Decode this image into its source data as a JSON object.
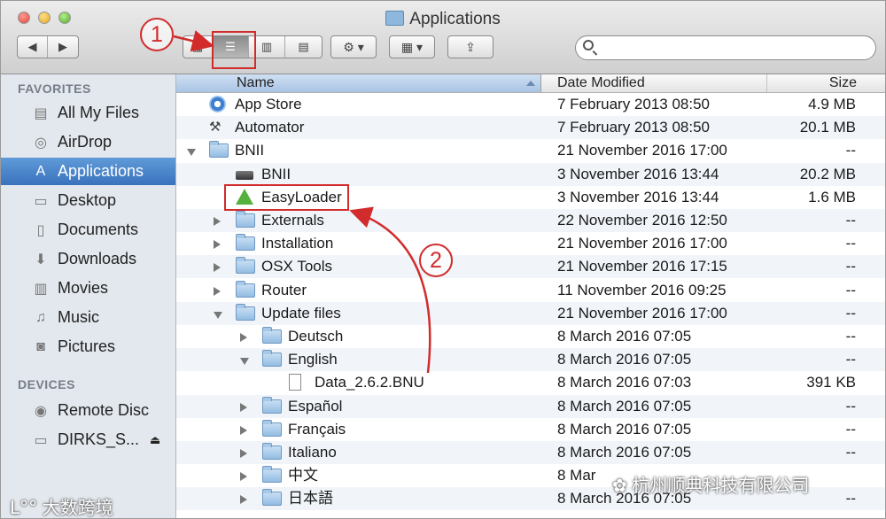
{
  "window": {
    "title": "Applications",
    "toolbar": {
      "back_label": "◀",
      "forward_label": "▶",
      "view_buttons": [
        "▦",
        "☰",
        "▥",
        "▤"
      ],
      "action_label": "⚙ ▾",
      "arrange_label": "▦ ▾",
      "share_label": "⇪"
    },
    "search": {
      "placeholder": ""
    }
  },
  "sidebar": {
    "favorites_heading": "FAVORITES",
    "favorites": [
      {
        "label": "All My Files",
        "icon": "all-files-icon",
        "glyph": "▤"
      },
      {
        "label": "AirDrop",
        "icon": "airdrop-icon",
        "glyph": "◎"
      },
      {
        "label": "Applications",
        "icon": "applications-icon",
        "glyph": "A"
      },
      {
        "label": "Desktop",
        "icon": "desktop-icon",
        "glyph": "▭"
      },
      {
        "label": "Documents",
        "icon": "documents-icon",
        "glyph": "▯"
      },
      {
        "label": "Downloads",
        "icon": "downloads-icon",
        "glyph": "⬇"
      },
      {
        "label": "Movies",
        "icon": "movies-icon",
        "glyph": "▥"
      },
      {
        "label": "Music",
        "icon": "music-icon",
        "glyph": "♫"
      },
      {
        "label": "Pictures",
        "icon": "pictures-icon",
        "glyph": "◙"
      }
    ],
    "selected_index": 2,
    "devices_heading": "DEVICES",
    "devices": [
      {
        "label": "Remote Disc",
        "icon": "disc-icon",
        "glyph": "◉"
      },
      {
        "label": "DIRKS_S...",
        "icon": "drive-icon",
        "glyph": "▭",
        "eject": "⏏"
      }
    ]
  },
  "columns": {
    "name": "Name",
    "date": "Date Modified",
    "size": "Size"
  },
  "rows": [
    {
      "name": "App Store",
      "date": "7 February 2013 08:50",
      "size": "4.9 MB",
      "icon": "app-store-icon",
      "type": "appstore",
      "indent": 0,
      "disclosure": "none"
    },
    {
      "name": "Automator",
      "date": "7 February 2013 08:50",
      "size": "20.1 MB",
      "icon": "automator-icon",
      "type": "automator",
      "indent": 0,
      "disclosure": "none"
    },
    {
      "name": "BNII",
      "date": "21 November 2016 17:00",
      "size": "--",
      "icon": "folder-icon",
      "type": "folder",
      "indent": 0,
      "disclosure": "open"
    },
    {
      "name": "BNII",
      "date": "3 November 2016 13:44",
      "size": "20.2 MB",
      "icon": "bnii-app-icon",
      "type": "bnii",
      "indent": 1,
      "disclosure": "none"
    },
    {
      "name": "EasyLoader",
      "date": "3 November 2016 13:44",
      "size": "1.6 MB",
      "icon": "easyloader-icon",
      "type": "easyloader",
      "indent": 1,
      "disclosure": "none"
    },
    {
      "name": "Externals",
      "date": "22 November 2016 12:50",
      "size": "--",
      "icon": "folder-icon",
      "type": "folder",
      "indent": 1,
      "disclosure": "closed"
    },
    {
      "name": "Installation",
      "date": "21 November 2016 17:00",
      "size": "--",
      "icon": "folder-icon",
      "type": "folder",
      "indent": 1,
      "disclosure": "closed"
    },
    {
      "name": "OSX Tools",
      "date": "21 November 2016 17:15",
      "size": "--",
      "icon": "folder-icon",
      "type": "folder",
      "indent": 1,
      "disclosure": "closed"
    },
    {
      "name": "Router",
      "date": "11 November 2016 09:25",
      "size": "--",
      "icon": "folder-icon",
      "type": "folder",
      "indent": 1,
      "disclosure": "closed"
    },
    {
      "name": "Update files",
      "date": "21 November 2016 17:00",
      "size": "--",
      "icon": "folder-icon",
      "type": "folder",
      "indent": 1,
      "disclosure": "open"
    },
    {
      "name": "Deutsch",
      "date": "8 March 2016 07:05",
      "size": "--",
      "icon": "folder-icon",
      "type": "folder",
      "indent": 2,
      "disclosure": "closed"
    },
    {
      "name": "English",
      "date": "8 March 2016 07:05",
      "size": "--",
      "icon": "folder-icon",
      "type": "folder",
      "indent": 2,
      "disclosure": "open"
    },
    {
      "name": "Data_2.6.2.BNU",
      "date": "8 March 2016 07:03",
      "size": "391 KB",
      "icon": "document-icon",
      "type": "doc",
      "indent": 3,
      "disclosure": "none"
    },
    {
      "name": "Español",
      "date": "8 March 2016 07:05",
      "size": "--",
      "icon": "folder-icon",
      "type": "folder",
      "indent": 2,
      "disclosure": "closed"
    },
    {
      "name": "Français",
      "date": "8 March 2016 07:05",
      "size": "--",
      "icon": "folder-icon",
      "type": "folder",
      "indent": 2,
      "disclosure": "closed"
    },
    {
      "name": "Italiano",
      "date": "8 March 2016 07:05",
      "size": "--",
      "icon": "folder-icon",
      "type": "folder",
      "indent": 2,
      "disclosure": "closed"
    },
    {
      "name": "中文",
      "date": "8 Mar",
      "size": "",
      "icon": "folder-icon",
      "type": "folder",
      "indent": 2,
      "disclosure": "closed"
    },
    {
      "name": "日本語",
      "date": "8 March 2016 07:05",
      "size": "--",
      "icon": "folder-icon",
      "type": "folder",
      "indent": 2,
      "disclosure": "closed"
    }
  ],
  "annotations": {
    "marker_1": "1",
    "marker_2": "2",
    "color": "#d22b2b"
  },
  "watermarks": {
    "left": "大数跨境",
    "right": "杭州顺典科技有限公司"
  }
}
